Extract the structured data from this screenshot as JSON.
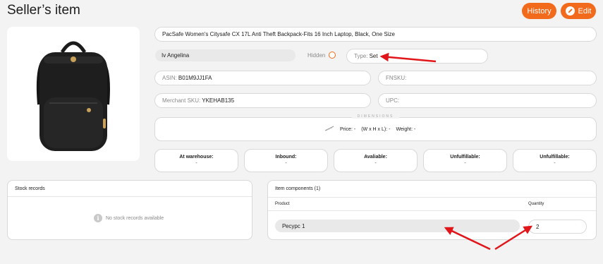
{
  "header": {
    "title": "Seller’s item",
    "history_label": "History",
    "edit_label": "Edit"
  },
  "colors": {
    "accent": "#f26a1b",
    "annotation_arrow": "#e0161a",
    "background": "#f3f3f3"
  },
  "item": {
    "title": "PacSafe Women's Citysafe CX 17L Anti Theft Backpack-Fits 16 Inch Laptop, Black, One Size",
    "seller": "Iv Angelina",
    "hidden_label": "Hidden",
    "type_label": "Type:",
    "type_value": "Set",
    "asin_label": "ASIN:",
    "asin_value": "B01M9JJ1FA",
    "fnsku_label": "FNSKU:",
    "fnsku_value": "",
    "merchant_sku_label": "Merchant SKU:",
    "merchant_sku_value": "YKEHAB135",
    "upc_label": "UPC:",
    "upc_value": ""
  },
  "dimensions": {
    "section_title": "DIMENSIONS",
    "price_label": "Price:",
    "price_value": "-",
    "size_label": "(W x H x L):",
    "size_value": "-",
    "weight_label": "Weight:",
    "weight_value": "-"
  },
  "stock_stats": [
    {
      "label": "At warehouse:",
      "value": "-"
    },
    {
      "label": "Inbound:",
      "value": "-"
    },
    {
      "label": "Avaliable:",
      "value": "-"
    },
    {
      "label": "Unfulfillable:",
      "value": "-"
    },
    {
      "label": "Unfulfillable:",
      "value": "-"
    }
  ],
  "stock_records": {
    "title": "Stock records",
    "empty_message": "No stock records available"
  },
  "components": {
    "title": "Item components (1)",
    "col_product": "Product",
    "col_quantity": "Quantity",
    "rows": [
      {
        "product": "Ресурс 1",
        "quantity": "2"
      }
    ]
  }
}
